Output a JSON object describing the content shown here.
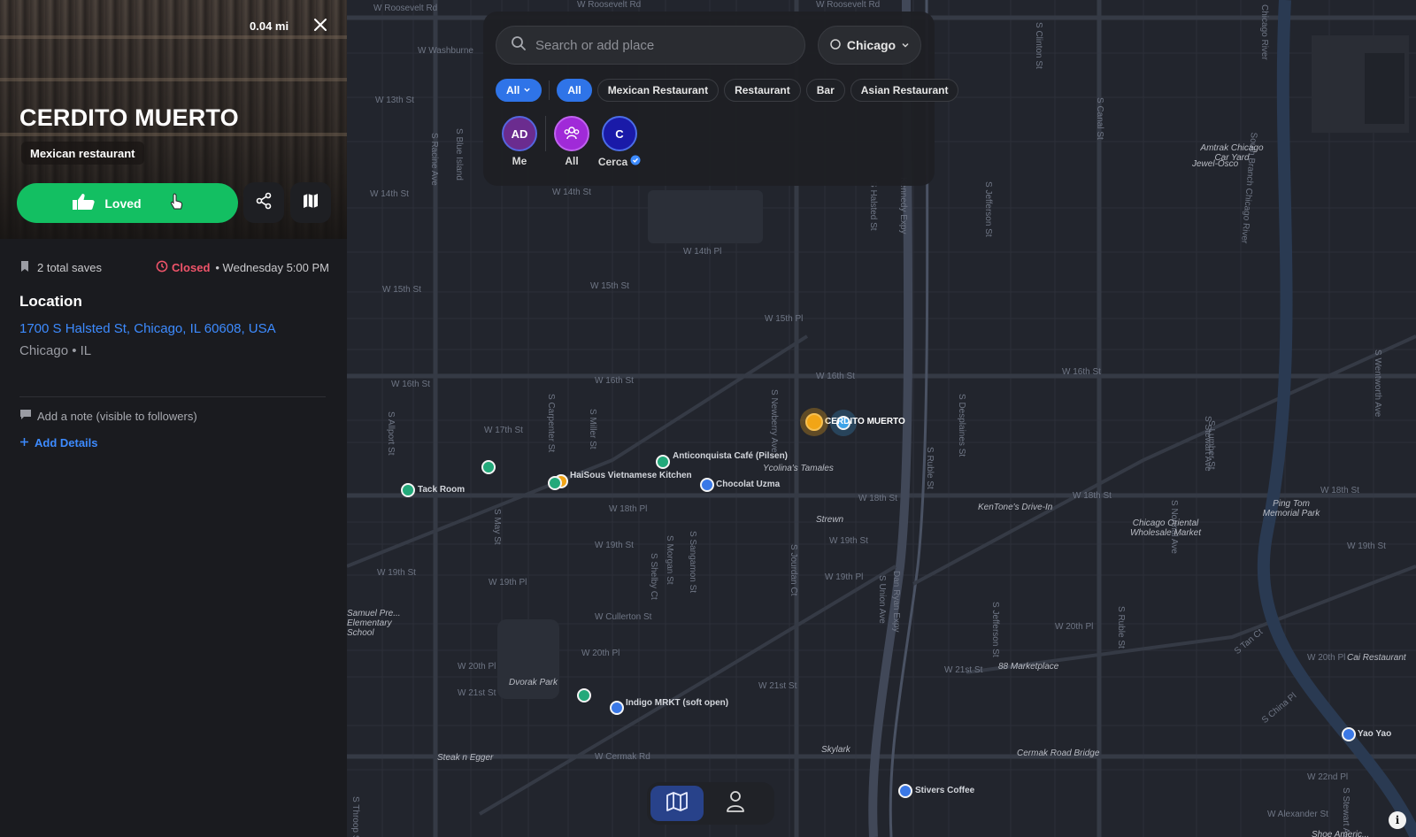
{
  "place": {
    "distance": "0.04 mi",
    "name": "CERDITO MUERTO",
    "category": "Mexican restaurant",
    "loved_label": "Loved",
    "saves": "2 total saves",
    "status": "Closed",
    "hours": "• Wednesday 5:00 PM",
    "location_heading": "Location",
    "address": "1700 S Halsted St, Chicago, IL 60608, USA",
    "city": "Chicago • IL",
    "note_placeholder": "Add a note (visible to followers)",
    "add_details": "Add Details"
  },
  "search": {
    "placeholder": "Search or add place",
    "city": "Chicago"
  },
  "filters": {
    "dropdown": "All",
    "chips": [
      "All",
      "Mexican Restaurant",
      "Restaurant",
      "Bar",
      "Asian Restaurant"
    ]
  },
  "people": [
    {
      "initials": "AD",
      "label": "Me"
    },
    {
      "initials": "",
      "label": "All"
    },
    {
      "initials": "C",
      "label": "Cerca"
    }
  ],
  "map": {
    "streets": [
      "W Roosevelt Rd",
      "W Roosevelt Rd",
      "W Roosevelt Rd",
      "W Washburne",
      "W 13th St",
      "W 14th St",
      "W 14th St",
      "W 14th Pl",
      "W 15th St",
      "W 15th St",
      "W 15th Pl",
      "W 16th St",
      "W 16th St",
      "W 16th St",
      "W 16th St",
      "W 17th St",
      "W 18th Pl",
      "W 18th St",
      "W 18th St",
      "W 18th St",
      "W 19th St",
      "W 19th St",
      "W 19th St",
      "W 19th St",
      "W 19th Pl",
      "W 19th Pl",
      "W Cullerton St",
      "W 20th Pl",
      "W 20th Pl",
      "W 20th Pl",
      "W 20th Pl",
      "W 21st St",
      "W 21st St",
      "W 21st St",
      "W 22nd Pl",
      "W Cermak Rd",
      "W Alexander St",
      "S Racine Ave",
      "S Blue Island",
      "S Allport St",
      "S Carpenter St",
      "S Miller St",
      "S May St",
      "S Newberry Ave",
      "S Jefferson St",
      "S Clinton St",
      "S Canal St",
      "S Union Ave",
      "S Ruble St",
      "S Desplaines St",
      "S Normal Ave",
      "S Stewart Ave",
      "S Halsted St",
      "S Morgan St",
      "S Sangamon St",
      "S Shelby Ct",
      "S Jourdan Ct",
      "Dan Ryan Expy",
      "Kennedy Expy",
      "S Wentworth Ave",
      "S Lumber St",
      "S China Pl",
      "S Tan Ct",
      "S Throop St",
      "S Stewart Ave",
      "S Jefferson St",
      "S Ruble St",
      "South Branch Chicago River",
      "Chicago River"
    ],
    "pois": [
      "Amtrak Chicago Car Yard",
      "Jewel-Osco",
      "KenTone's Drive-In",
      "Chicago Oriental Wholesale Market",
      "Ping Tom Memorial Park",
      "Ycolina's Tamales",
      "Strewn",
      "Dvorak Park",
      "Steak n Egger",
      "Skylark",
      "Cermak Road Bridge",
      "88 Marketplace",
      "Cai Restaurant",
      "Samuel Pre... Elementary School",
      "Shoe Americ..."
    ],
    "pins": [
      {
        "label": "CERDITO MUERTO",
        "color": "lightblue"
      },
      {
        "label": "",
        "color": "orange"
      },
      {
        "label": "Anticonquista Café (Pilsen)",
        "color": "green"
      },
      {
        "label": "HaiSous Vietnamese Kitchen",
        "color": "green"
      },
      {
        "label": "",
        "color": "orange"
      },
      {
        "label": "Chocolat Uzma",
        "color": "blue"
      },
      {
        "label": "Tack Room",
        "color": "green"
      },
      {
        "label": "",
        "color": "green"
      },
      {
        "label": "Indigo MRKT (soft open)",
        "color": "blue"
      },
      {
        "label": "",
        "color": "green"
      },
      {
        "label": "Yao Yao",
        "color": "blue"
      },
      {
        "label": "Stivers Coffee",
        "color": "blue"
      }
    ]
  },
  "colors": {
    "accent": "#2f74e8",
    "loved": "#13bf62",
    "closed": "#f0546a",
    "link": "#3d8bff",
    "map_bg": "#22252d"
  }
}
